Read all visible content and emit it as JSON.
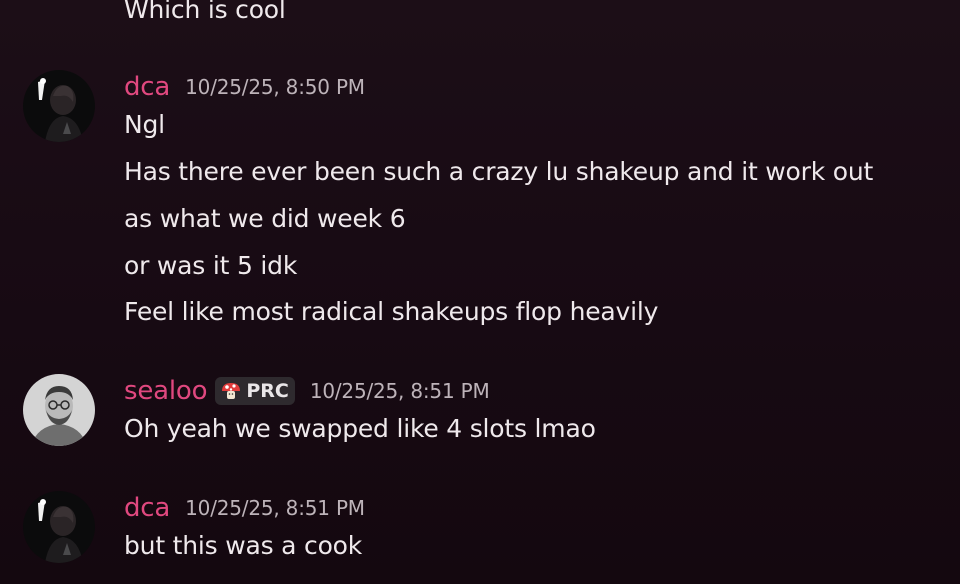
{
  "messages": [
    {
      "continuation": true,
      "lines": [
        "Which is cool"
      ]
    },
    {
      "username": "dca",
      "avatar_icon": "dark-portrait-avatar",
      "timestamp": "10/25/25, 8:50 PM",
      "lines": [
        "Ngl",
        "Has there ever been such a crazy lu shakeup and it work out",
        "as what we did week 6",
        "or was it 5 idk",
        "Feel like most radical shakeups flop heavily"
      ]
    },
    {
      "username": "sealoo",
      "avatar_icon": "bearded-man-avatar",
      "tag": {
        "icon": "mushroom-icon",
        "label": "PRC"
      },
      "timestamp": "10/25/25, 8:51 PM",
      "lines": [
        "Oh yeah we swapped like 4 slots lmao"
      ]
    },
    {
      "username": "dca",
      "avatar_icon": "dark-portrait-avatar",
      "timestamp": "10/25/25, 8:51 PM",
      "lines": [
        "but this was a cook"
      ]
    }
  ],
  "colors": {
    "username": "#e0487f",
    "timestamp": "#bdb3b9",
    "text": "#efe9ec",
    "background": "#1a0c15"
  }
}
